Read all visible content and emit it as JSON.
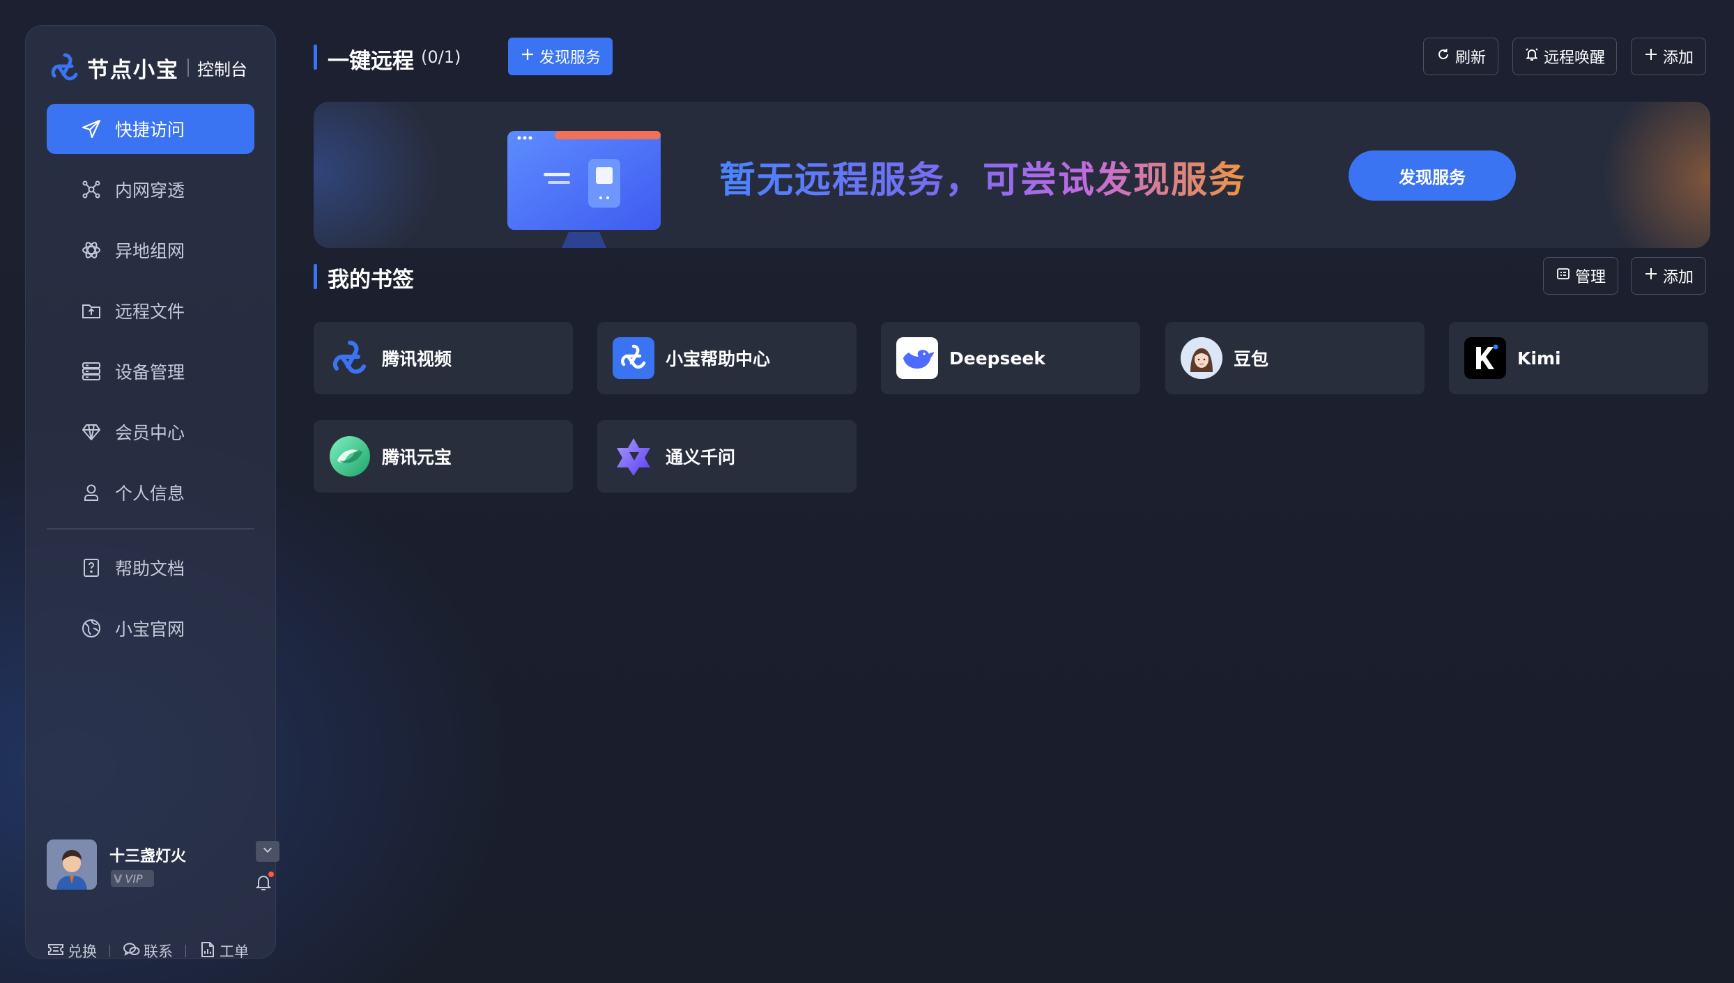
{
  "brand": {
    "name": "节点小宝",
    "sub": "控制台"
  },
  "sidebar": {
    "items": [
      {
        "label": "快捷访问",
        "icon": "paper-plane-icon",
        "active": true
      },
      {
        "label": "内网穿透",
        "icon": "network-nodes-icon"
      },
      {
        "label": "异地组网",
        "icon": "atom-icon"
      },
      {
        "label": "远程文件",
        "icon": "folder-upload-icon"
      },
      {
        "label": "设备管理",
        "icon": "server-icon"
      },
      {
        "label": "会员中心",
        "icon": "diamond-icon"
      },
      {
        "label": "个人信息",
        "icon": "user-icon"
      }
    ],
    "secondary": [
      {
        "label": "帮助文档",
        "icon": "help-doc-icon"
      },
      {
        "label": "小宝官网",
        "icon": "website-icon"
      }
    ],
    "user": {
      "name": "十三盏灯火",
      "badge": "VIP"
    },
    "footer": {
      "redeem": "兑换",
      "contact": "联系",
      "ticket": "工单"
    }
  },
  "remote": {
    "title": "一键远程",
    "count": "(0/1)",
    "discover_label": "发现服务",
    "refresh_label": "刷新",
    "wake_label": "远程唤醒",
    "add_label": "添加"
  },
  "banner": {
    "message": "暂无远程服务，可尝试发现服务",
    "button_label": "发现服务"
  },
  "bookmarks": {
    "title": "我的书签",
    "manage_label": "管理",
    "add_label": "添加",
    "items": [
      {
        "label": "腾讯视频",
        "icon": "tencent-video-logo-icon"
      },
      {
        "label": "小宝帮助中心",
        "icon": "xiaobao-help-logo-icon"
      },
      {
        "label": "Deepseek",
        "icon": "deepseek-logo-icon"
      },
      {
        "label": "豆包",
        "icon": "doubao-logo-icon"
      },
      {
        "label": "Kimi",
        "icon": "kimi-logo-icon"
      },
      {
        "label": "腾讯元宝",
        "icon": "yuanbao-logo-icon"
      },
      {
        "label": "通义千问",
        "icon": "qwen-logo-icon"
      }
    ]
  },
  "colors": {
    "accent": "#3a74f3",
    "background": "#1b1f2c",
    "card": "#292e3d",
    "sidebar": "#2c3348"
  }
}
